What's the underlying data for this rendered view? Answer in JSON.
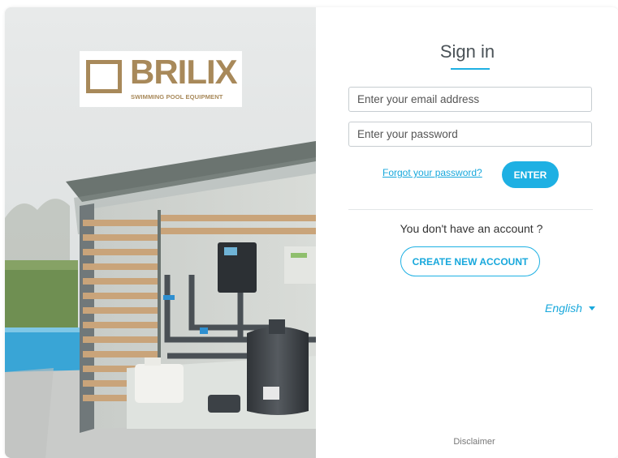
{
  "brand": {
    "name": "BRILIX",
    "tagline": "SWIMMING POOL EQUIPMENT",
    "color": "#a8895a"
  },
  "signin": {
    "title": "Sign in",
    "email_placeholder": "Enter your email address",
    "password_placeholder": "Enter your password",
    "forgot_label": "Forgot your password?",
    "enter_label": "ENTER"
  },
  "account": {
    "prompt": "You don't have an account ?",
    "create_label": "CREATE NEW ACCOUNT"
  },
  "language": {
    "selected": "English",
    "icon": "caret-down-icon"
  },
  "footer": {
    "disclaimer": "Disclaimer"
  },
  "colors": {
    "accent": "#1eb0e3",
    "text": "#333333"
  }
}
